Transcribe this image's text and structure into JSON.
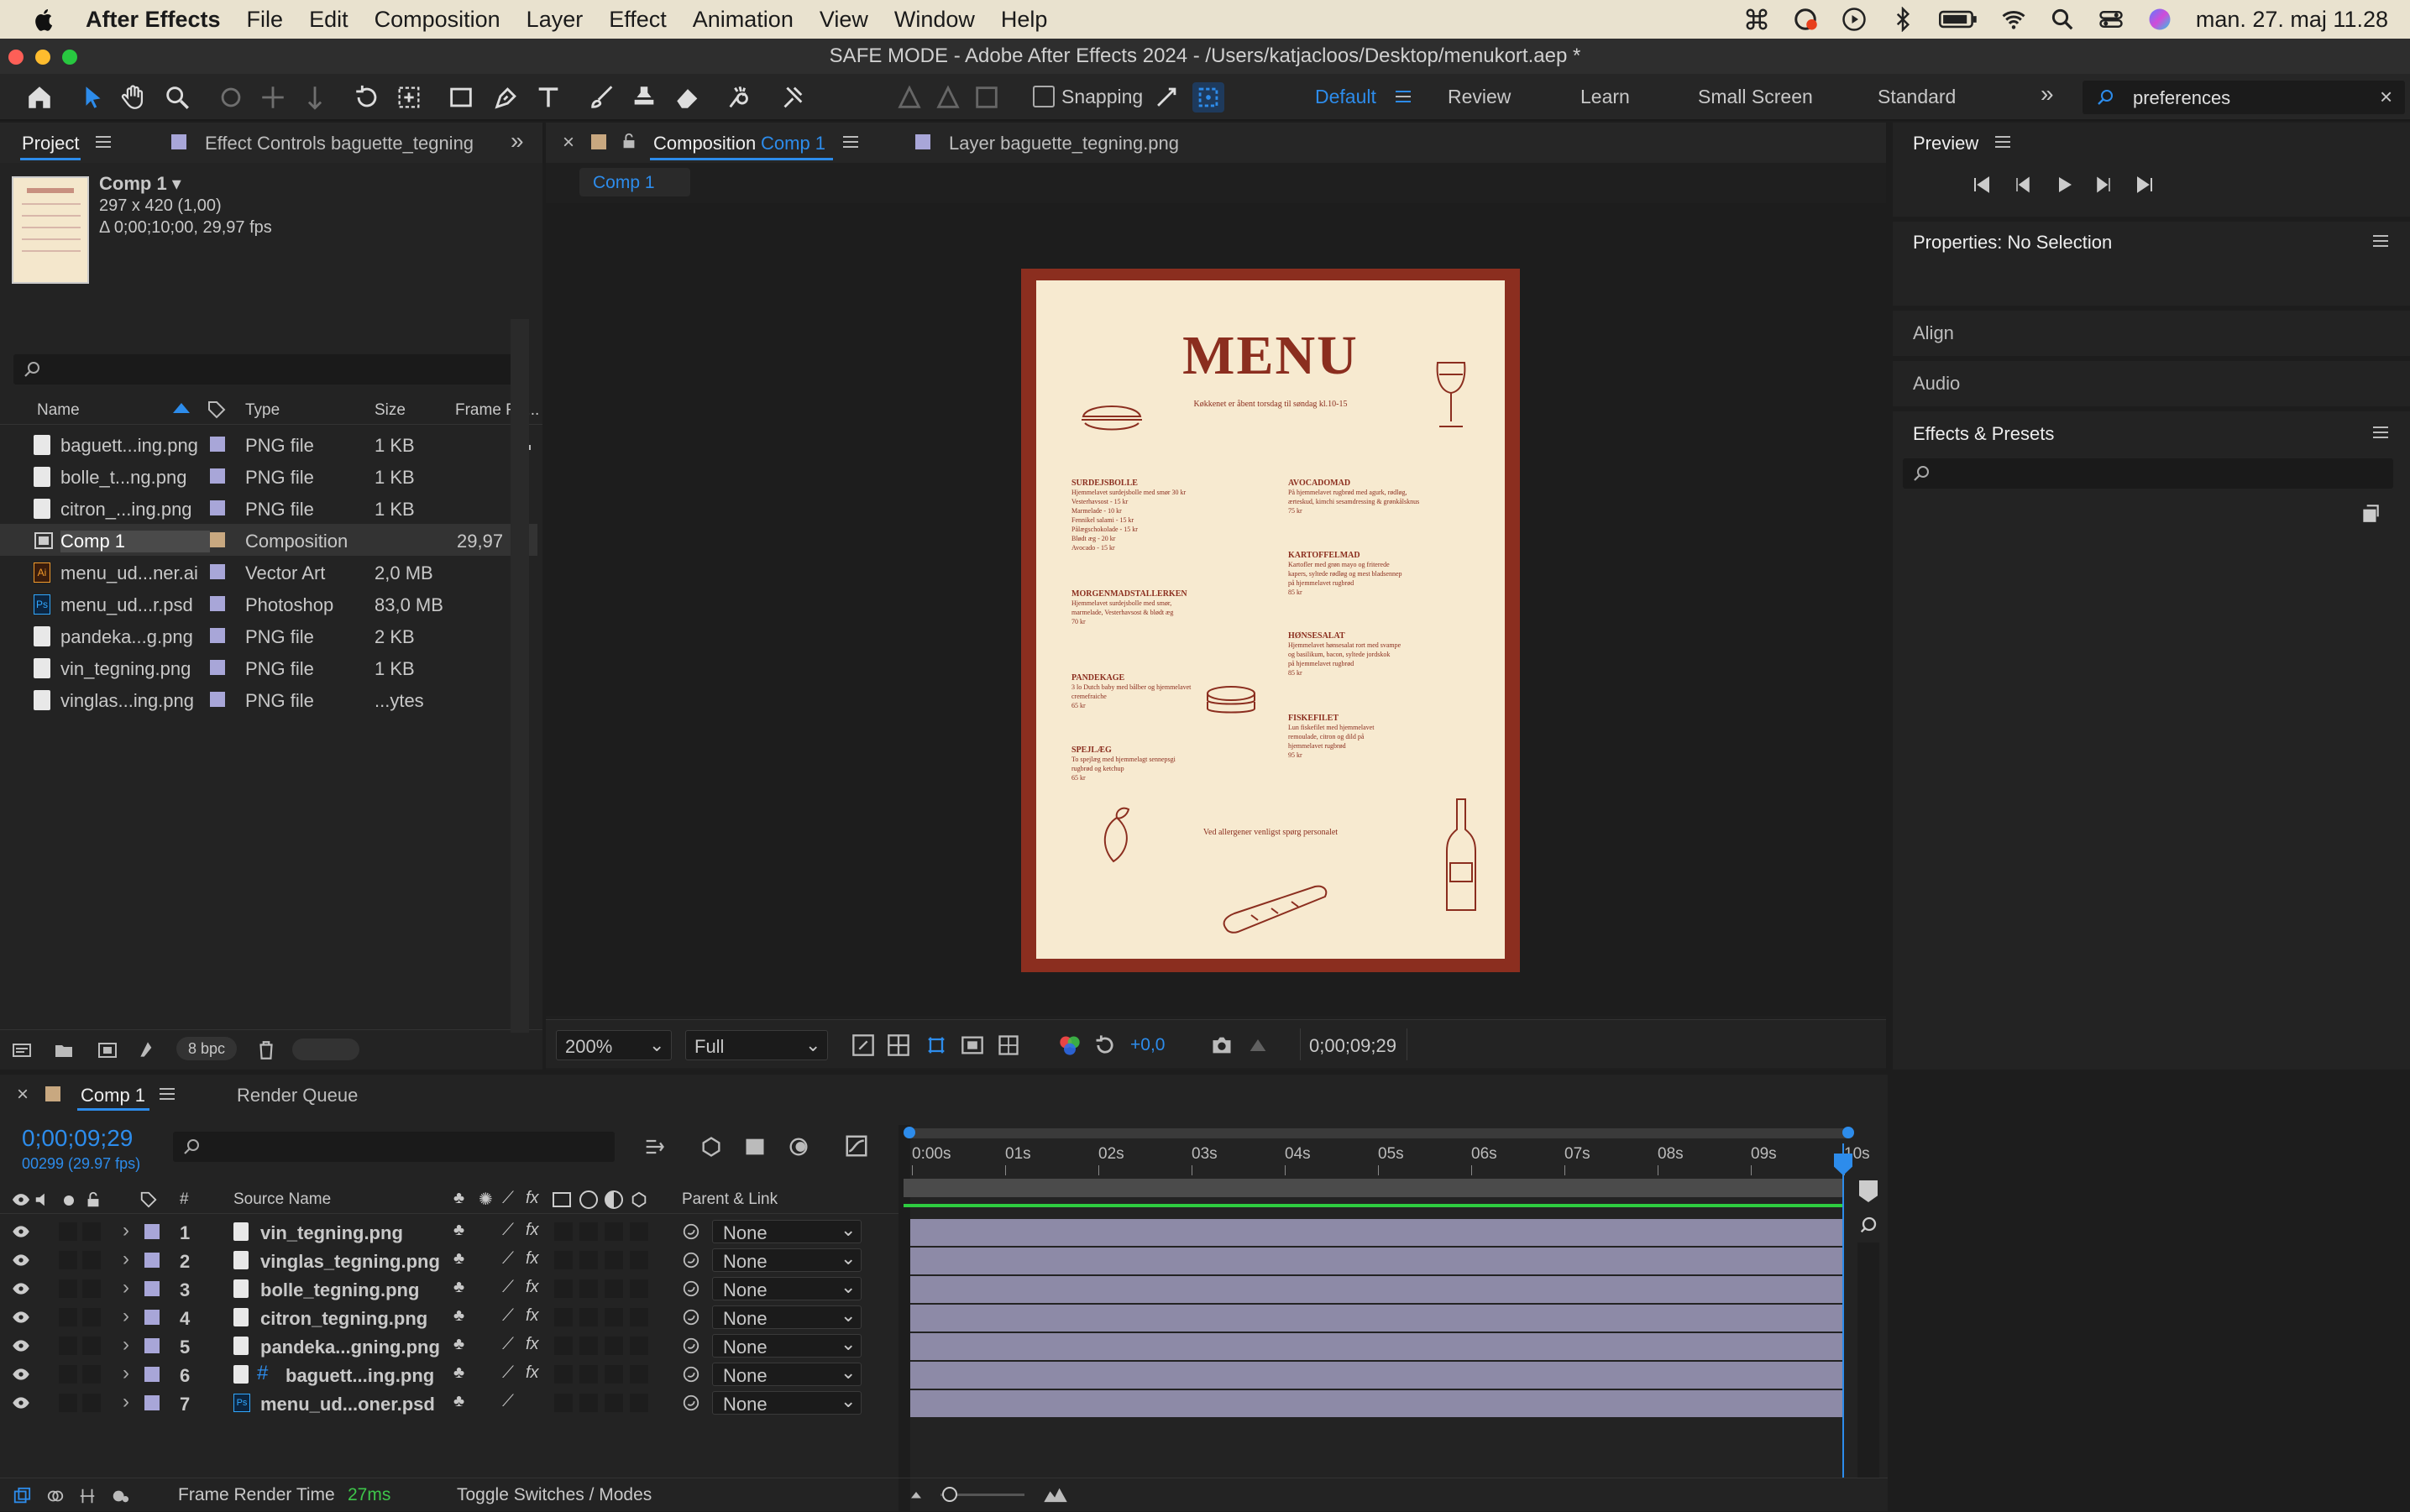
{
  "menubar": {
    "app": "After Effects",
    "items": [
      "File",
      "Edit",
      "Composition",
      "Layer",
      "Effect",
      "Animation",
      "View",
      "Window",
      "Help"
    ],
    "clock": "man. 27. maj  11.28"
  },
  "titlebar": {
    "title": "SAFE MODE - Adobe After Effects 2024 - /Users/katjacloos/Desktop/menukort.aep *"
  },
  "toolbar": {
    "snapping": "Snapping",
    "workspaces": [
      "Default",
      "Review",
      "Learn",
      "Small Screen",
      "Standard"
    ],
    "search_value": "preferences"
  },
  "project": {
    "tab": "Project",
    "tab2": "Effect Controls baguette_tegning",
    "comp_name": "Comp 1 ▾",
    "comp_size": "297 x 420 (1,00)",
    "comp_dur": "Δ 0;00;10;00, 29,97 fps",
    "columns": [
      "Name",
      "Type",
      "Size",
      "Frame Ra..."
    ],
    "items": [
      {
        "name": "baguett...ing.png",
        "type": "PNG file",
        "size": "1 KB",
        "fr": ""
      },
      {
        "name": "bolle_t...ng.png",
        "type": "PNG file",
        "size": "1 KB",
        "fr": ""
      },
      {
        "name": "citron_...ing.png",
        "type": "PNG file",
        "size": "1 KB",
        "fr": ""
      },
      {
        "name": "Comp 1",
        "type": "Composition",
        "size": "",
        "fr": "29,97"
      },
      {
        "name": "menu_ud...ner.ai",
        "type": "Vector Art",
        "size": "2,0 MB",
        "fr": ""
      },
      {
        "name": "menu_ud...r.psd",
        "type": "Photoshop",
        "size": "83,0 MB",
        "fr": ""
      },
      {
        "name": "pandeka...g.png",
        "type": "PNG file",
        "size": "2 KB",
        "fr": ""
      },
      {
        "name": "vin_tegning.png",
        "type": "PNG file",
        "size": "1 KB",
        "fr": ""
      },
      {
        "name": "vinglas...ing.png",
        "type": "PNG file",
        "size": "...ytes",
        "fr": ""
      }
    ],
    "bpc": "8 bpc"
  },
  "viewer": {
    "tab": "Composition",
    "tab_comp": "Comp 1",
    "tab_layer": "Layer baguette_tegning.png",
    "subtab": "Comp 1",
    "zoom": "200%",
    "resolution": "Full",
    "exposure": "+0,0",
    "timecode": "0;00;09;29"
  },
  "menu": {
    "title": "MENU",
    "subtitle": "Køkkenet er åbent torsdag til søndag kl.10-15",
    "left": [
      {
        "h": "SURDEJSBOLLE",
        "t": "Hjemmelavet surdejsbolle med smør 30 kr\nVesterhavsost - 15 kr\nMarmelade - 10 kr\nFennikel salami - 15 kr\nPålægschokolade - 15 kr\nBlødt æg - 20 kr\nAvocado - 15 kr"
      },
      {
        "h": "MORGENMADSTALLERKEN",
        "t": "Hjemmelavet surdejsbolle med smør,\nmarmelade, Vesterhavsost & blødt æg\n70 kr"
      },
      {
        "h": "PANDEKAGE",
        "t": "3 lo Dutch baby med bålber og hjemmelavet\ncremefraiche\n65 kr"
      },
      {
        "h": "SPEJLÆG",
        "t": "To spejlæg med hjemmelagt sennepsgi\nrugbrød og ketchup\n65 kr"
      }
    ],
    "right": [
      {
        "h": "AVOCADOMAD",
        "t": "På hjemmelavet rugbrød med agurk, rødløg,\nærteskud, kimchi sesamdressing & grønkålsknus\n75 kr"
      },
      {
        "h": "KARTOFFELMAD",
        "t": "Kartofler med grøn mayo og friterede\nkapers, syltede rødløg og mest bladsennep\npå hjemmelavet rugbrød\n85 kr"
      },
      {
        "h": "HØNSESALAT",
        "t": "Hjemmelavet hønsesalat rort med svampe\nog basilikum, bacon, syltede jordskok\npå hjemmelavet rugbrød\n85 kr"
      },
      {
        "h": "FISKEFILET",
        "t": "Lun fiskefilet med hjemmelavet\nremoulade, citron og dild på\nhjemmelavet rugbrød\n95 kr"
      }
    ],
    "allergy": "Ved allergener venligst spørg personalet"
  },
  "right_panel": {
    "preview": "Preview",
    "properties": "Properties: No Selection",
    "align": "Align",
    "audio": "Audio",
    "effects": "Effects & Presets"
  },
  "timeline": {
    "tab": "Comp 1",
    "render_queue": "Render Queue",
    "timecode": "0;00;09;29",
    "fps": "00299 (29.97 fps)",
    "col_num": "#",
    "col_source": "Source Name",
    "col_parent": "Parent & Link",
    "ruler": [
      "0:00s",
      "01s",
      "02s",
      "03s",
      "04s",
      "05s",
      "06s",
      "07s",
      "08s",
      "09s",
      "10s"
    ],
    "layers": [
      {
        "n": "1",
        "name": "vin_tegning.png",
        "parent": "None"
      },
      {
        "n": "2",
        "name": "vinglas_tegning.png",
        "parent": "None"
      },
      {
        "n": "3",
        "name": "bolle_tegning.png",
        "parent": "None"
      },
      {
        "n": "4",
        "name": "citron_tegning.png",
        "parent": "None"
      },
      {
        "n": "5",
        "name": "pandeka...gning.png",
        "parent": "None"
      },
      {
        "n": "6",
        "name": "baguett...ing.png",
        "parent": "None"
      },
      {
        "n": "7",
        "name": "menu_ud...oner.psd",
        "parent": "None"
      }
    ],
    "frame_render_label": "Frame Render Time",
    "frame_render_value": "27ms",
    "toggle": "Toggle Switches / Modes"
  },
  "colors": {
    "accent": "#2d8ceb",
    "menu_red": "#8b2e1f",
    "menu_bg": "#f7ead0",
    "layer_bar": "#8d8aa7",
    "work_area_green": "#2ecc40"
  }
}
